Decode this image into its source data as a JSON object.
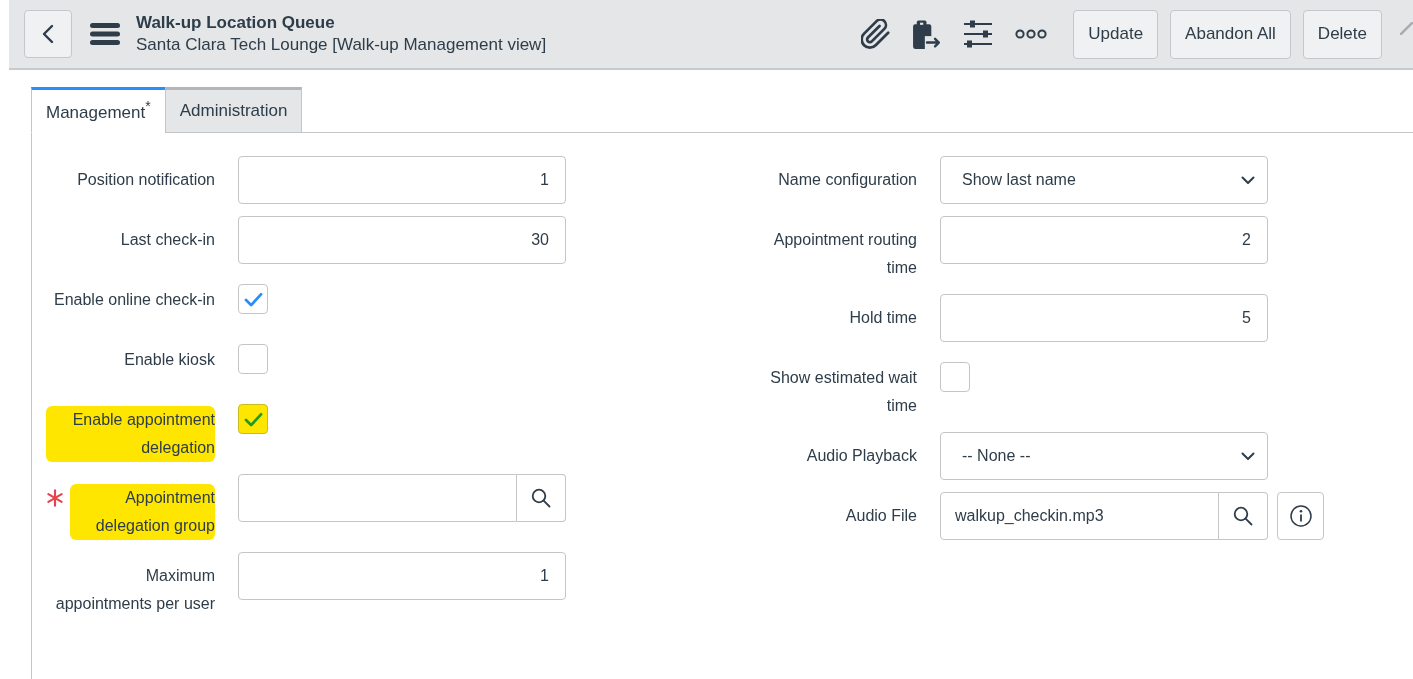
{
  "header": {
    "title": "Walk-up Location Queue",
    "subtitle": "Santa Clara Tech Lounge [Walk-up Management view]",
    "buttons": [
      "Update",
      "Abandon All",
      "Delete"
    ]
  },
  "tabs": [
    {
      "label": "Management$^{*}$",
      "selected": true
    },
    {
      "label": "Administration",
      "selected": false
    }
  ],
  "form": {
    "columns": [
      {
        "fields": [
          {
            "kind": "number",
            "label": "Position notification",
            "value": "1",
            "required": false,
            "highlighted": false
          },
          {
            "kind": "number",
            "label": "Last check-in",
            "value": "30",
            "required": false,
            "highlighted": false
          },
          {
            "kind": "checkbox",
            "label": "Enable online check-in",
            "checked": true,
            "required": false,
            "highlighted": false
          },
          {
            "kind": "checkbox",
            "label": "Enable kiosk",
            "checked": false,
            "required": false,
            "highlighted": false
          },
          {
            "kind": "checkbox",
            "label": "Enable appointment delegation",
            "checked": true,
            "required": false,
            "highlighted": true
          },
          {
            "kind": "lookup",
            "label": "Appointment delegation group",
            "info": false,
            "required": true,
            "highlighted": true
          },
          {
            "kind": "number",
            "label": "Maximum appointments per user",
            "value": "1",
            "required": false,
            "highlighted": false
          }
        ]
      },
      {
        "fields": [
          {
            "kind": "select",
            "label": "Name configuration",
            "value": "Show last name",
            "required": false,
            "highlighted": false
          },
          {
            "kind": "number",
            "label": "Appointment routing time",
            "value": "2",
            "required": false,
            "highlighted": false
          },
          {
            "kind": "number",
            "label": "Hold time",
            "value": "5",
            "required": false,
            "highlighted": false
          },
          {
            "kind": "checkbox",
            "label": "Show estimated wait time",
            "checked": false,
            "required": false,
            "highlighted": false
          },
          {
            "kind": "select",
            "label": "Audio Playback",
            "value": "-- None --",
            "required": false,
            "highlighted": false
          },
          {
            "kind": "lookup",
            "label": "Audio File",
            "value": "walkup_checkin.mp3",
            "info": true,
            "required": false,
            "highlighted": false
          }
        ]
      }
    ]
  }
}
